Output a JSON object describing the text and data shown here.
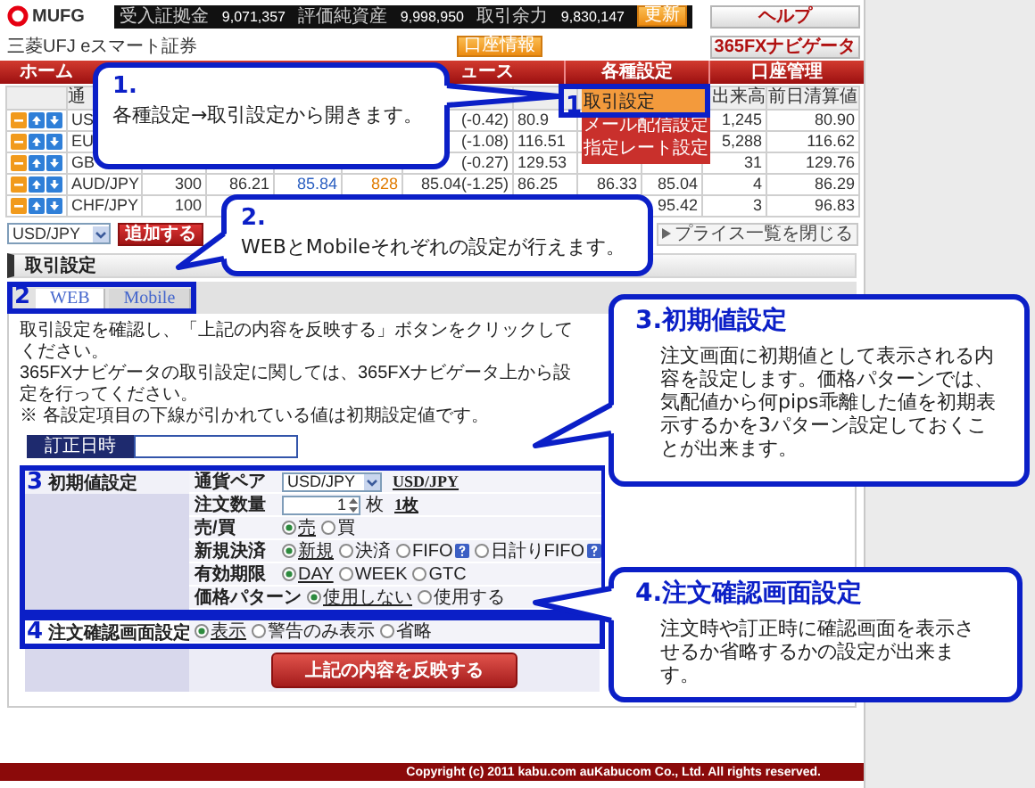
{
  "header": {
    "logo": "MUFG",
    "subtitle": "三菱UFJ eスマート証券",
    "account_summary": [
      {
        "label": "受入証拠金",
        "value": "9,071,357"
      },
      {
        "label": "評価純資産",
        "value": "9,998,950"
      },
      {
        "label": "取引余力",
        "value": "9,830,147"
      }
    ],
    "refresh_button": "更新",
    "account_button": "口座情報",
    "help_button": "ヘルプ",
    "navigator_button": "365FXナビゲータ"
  },
  "nav": [
    "ホーム",
    "ュース",
    "各種設定",
    "口座管理"
  ],
  "menu": {
    "marker": "1",
    "items": [
      {
        "label": "取引設定",
        "selected": true
      },
      {
        "label": "メール配信設定",
        "selected": false
      },
      {
        "label": "指定レート設定",
        "selected": false
      }
    ]
  },
  "price_table": {
    "columns": [
      "通",
      null,
      null,
      null,
      null,
      null,
      null,
      null,
      null,
      "出来高",
      "前日清算値"
    ],
    "rows": [
      {
        "cells": [
          "US",
          null,
          null,
          null,
          null,
          "(-0.42)",
          "80.9",
          null,
          null,
          "1,245",
          "80.90"
        ]
      },
      {
        "cells": [
          "EU",
          null,
          null,
          null,
          null,
          "(-1.08)",
          "116.51",
          null,
          null,
          "5,288",
          "116.62"
        ]
      },
      {
        "cells": [
          "GB",
          null,
          null,
          null,
          null,
          "(-0.27)",
          "129.53",
          null,
          null,
          "31",
          "129.76"
        ]
      },
      {
        "cells": [
          "AUD/JPY",
          "300",
          "86.21",
          "85.84",
          "828",
          "85.04(-1.25)",
          "86.25",
          "86.33",
          "85.04",
          "4",
          "86.29"
        ]
      },
      {
        "cells": [
          "CHF/JPY",
          "100",
          null,
          null,
          null,
          null,
          null,
          null,
          "95.42",
          "3",
          "96.83"
        ]
      }
    ]
  },
  "pair_bar": {
    "pair": "USD/JPY",
    "add_button": "追加する",
    "close_button": "プライス一覧を閉じる"
  },
  "section": {
    "title": "取引設定",
    "tabs_marker": "2",
    "tabs": [
      {
        "label": "WEB",
        "selected": true
      },
      {
        "label": "Mobile",
        "selected": false
      }
    ],
    "instructions": [
      "取引設定を確認し、「上記の内容を反映する」ボタンをクリックしてください。",
      "365FXナビゲータの取引設定に関しては、365FXナビゲータ上から設定を行ってください。",
      "※ 各設定項目の下線が引かれている値は初期設定値です。"
    ],
    "correction_time": {
      "label": "訂正日時"
    },
    "initial_settings": {
      "marker": "3",
      "title": "初期値設定",
      "rows": [
        {
          "kind": "select",
          "label": "通貨ペア",
          "value": "USD/JPY",
          "default_text": "USD/JPY"
        },
        {
          "kind": "number",
          "label": "注文数量",
          "value": "1",
          "unit": "枚",
          "default_text": "1枚"
        },
        {
          "kind": "radio",
          "label": "売/買",
          "options": [
            {
              "label": "売",
              "checked": true,
              "default": true
            },
            {
              "label": "買",
              "checked": false,
              "default": false
            }
          ]
        },
        {
          "kind": "radio",
          "label": "新規決済",
          "options": [
            {
              "label": "新規",
              "checked": true,
              "default": true,
              "help": false
            },
            {
              "label": "決済",
              "checked": false,
              "default": false,
              "help": false
            },
            {
              "label": "FIFO",
              "checked": false,
              "default": false,
              "help": true
            },
            {
              "label": "日計りFIFO",
              "checked": false,
              "default": false,
              "help": true
            }
          ]
        },
        {
          "kind": "radio",
          "label": "有効期限",
          "options": [
            {
              "label": "DAY",
              "checked": true,
              "default": true
            },
            {
              "label": "WEEK",
              "checked": false,
              "default": false
            },
            {
              "label": "GTC",
              "checked": false,
              "default": false
            }
          ]
        },
        {
          "kind": "radio",
          "label": "価格パターン",
          "options": [
            {
              "label": "使用しない",
              "checked": true,
              "default": true
            },
            {
              "label": "使用する",
              "checked": false,
              "default": false
            }
          ]
        }
      ]
    },
    "confirm_settings": {
      "marker": "4",
      "title": "注文確認画面設定",
      "options": [
        {
          "label": "表示",
          "checked": true,
          "default": true
        },
        {
          "label": "警告のみ表示",
          "checked": false,
          "default": false
        },
        {
          "label": "省略",
          "checked": false,
          "default": false
        }
      ]
    },
    "apply_button": "上記の内容を反映する"
  },
  "footer": {
    "copyright": "Copyright (c) 2011 kabu.com auKabucom Co., Ltd. All rights reserved."
  },
  "callouts": [
    {
      "heading": "1.",
      "text": "各種設定→取引設定から開きます。"
    },
    {
      "heading": "2.",
      "text": "WEBとMobileそれぞれの設定が行えます。"
    },
    {
      "heading": "3.初期値設定",
      "text": "注文画面に初期値として表示される内容を設定します。価格パターンでは、気配値から何pips乖離した値を初期表示するかを3パターン設定しておくことが出来ます。"
    },
    {
      "heading": "4.注文確認画面設定",
      "text": "注文時や訂正時に確認画面を表示させるか省略するかの設定が出来ます。"
    }
  ]
}
